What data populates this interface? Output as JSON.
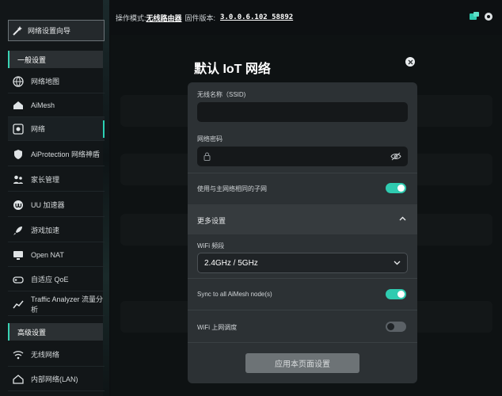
{
  "topbar": {
    "mode_label": "操作模式:",
    "mode_value": "无线路由器",
    "firmware_label": "固件版本:",
    "firmware_value": "3.0.0.6.102_58892"
  },
  "sidebar": {
    "wizard_label": "网络设置向导",
    "section_general": "一般设置",
    "section_advanced": "高级设置",
    "items": [
      {
        "label": "网络地图"
      },
      {
        "label": "AiMesh"
      },
      {
        "label": "网络"
      },
      {
        "label": "AiProtection 网络神盾"
      },
      {
        "label": "家长管理"
      },
      {
        "label": "UU 加速器"
      },
      {
        "label": "游戏加速"
      },
      {
        "label": "Open NAT"
      },
      {
        "label": "自适应 QoE"
      },
      {
        "label": "Traffic Analyzer 流量分析"
      }
    ],
    "advanced_items": [
      {
        "label": "无线网络"
      },
      {
        "label": "内部网络(LAN)"
      }
    ]
  },
  "modal": {
    "title": "默认 IoT 网络",
    "ssid_label": "无线名称（SSID)",
    "ssid_value": "",
    "password_label": "网络密码",
    "password_value": "",
    "same_subnet_label": "使用与主网络相同的子网",
    "same_subnet_on": true,
    "more_settings_label": "更多设置",
    "band_label": "WiFi 频段",
    "band_value": "2.4GHz / 5GHz",
    "sync_label": "Sync to all AiMesh node(s)",
    "sync_on": true,
    "schedule_label": "WiFi 上网调度",
    "schedule_on": false,
    "apply_label": "应用本页面设置"
  },
  "colors": {
    "accent": "#2fcbb0",
    "panel": "#2c3134",
    "background": "#0d1012"
  }
}
